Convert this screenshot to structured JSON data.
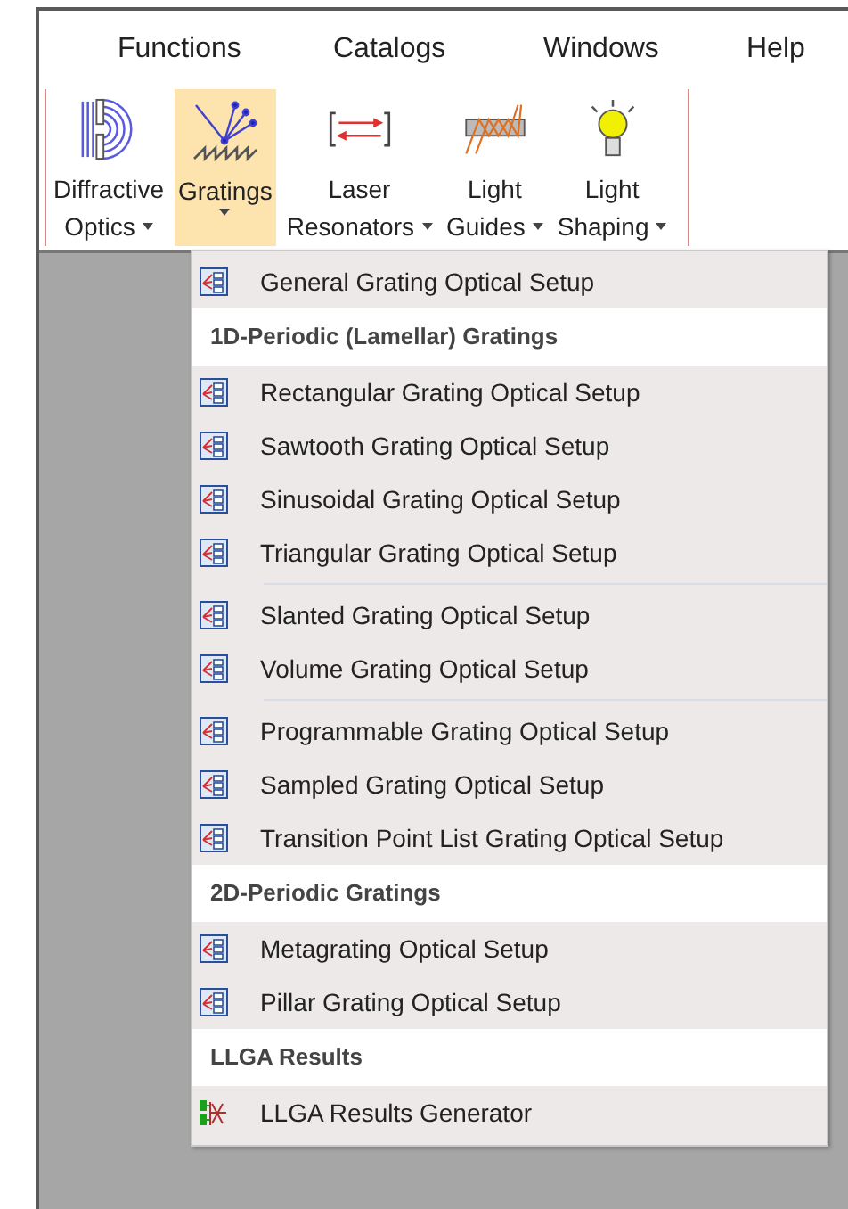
{
  "menu_bar": [
    {
      "label": "Functions"
    },
    {
      "label": "Catalogs"
    },
    {
      "label": "Windows"
    },
    {
      "label": "Help"
    }
  ],
  "ribbon": [
    {
      "line1": "Diffractive",
      "line2": "Optics",
      "selected": false
    },
    {
      "line1": "Gratings",
      "selected": true
    },
    {
      "line1": "Laser",
      "line2": "Resonators",
      "selected": false
    },
    {
      "line1": "Light",
      "line2": "Guides",
      "selected": false
    },
    {
      "line1": "Light",
      "line2": "Shaping",
      "selected": false
    }
  ],
  "dropdown": [
    {
      "kind": "setup",
      "label": "General Grating Optical Setup"
    },
    {
      "kind": "header",
      "label": "1D-Periodic (Lamellar) Gratings"
    },
    {
      "kind": "setup",
      "label": "Rectangular Grating Optical Setup"
    },
    {
      "kind": "setup",
      "label": "Sawtooth Grating Optical Setup"
    },
    {
      "kind": "setup",
      "label": "Sinusoidal Grating Optical Setup"
    },
    {
      "kind": "setup",
      "label": "Triangular Grating Optical Setup"
    },
    {
      "kind": "separator"
    },
    {
      "kind": "setup",
      "label": "Slanted Grating Optical Setup"
    },
    {
      "kind": "setup",
      "label": "Volume Grating Optical Setup"
    },
    {
      "kind": "separator"
    },
    {
      "kind": "setup",
      "label": "Programmable Grating Optical Setup"
    },
    {
      "kind": "setup",
      "label": "Sampled Grating Optical Setup"
    },
    {
      "kind": "setup",
      "label": "Transition Point List Grating Optical Setup"
    },
    {
      "kind": "header",
      "label": "2D-Periodic Gratings"
    },
    {
      "kind": "setup",
      "label": "Metagrating Optical Setup"
    },
    {
      "kind": "setup",
      "label": "Pillar Grating Optical Setup"
    },
    {
      "kind": "header",
      "label": "LLGA Results"
    },
    {
      "kind": "generator",
      "label": "LLGA Results Generator"
    }
  ]
}
